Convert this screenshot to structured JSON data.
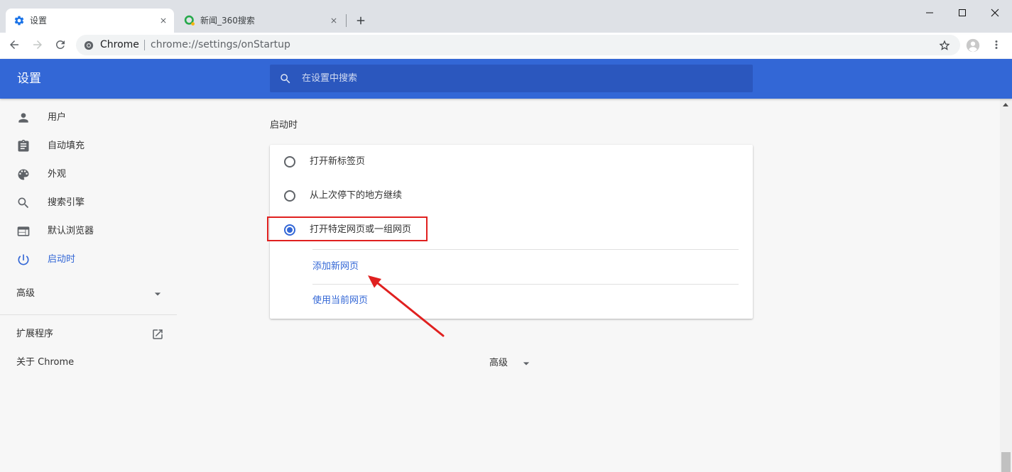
{
  "tabs": [
    {
      "title": "设置",
      "icon": "settings-gear-icon",
      "active": true
    },
    {
      "title": "新闻_360搜索",
      "icon": "360-search-icon",
      "active": false
    }
  ],
  "window_controls": [
    "minimize-icon",
    "maximize-icon",
    "close-icon"
  ],
  "toolbar": {
    "site_chip": "Chrome",
    "url": "chrome://settings/onStartup",
    "icons": [
      "back-arrow-icon",
      "forward-arrow-icon",
      "reload-icon",
      "bookmark-star-icon",
      "profile-avatar-icon",
      "more-menu-icon"
    ]
  },
  "header": {
    "title": "设置",
    "search_placeholder": "在设置中搜索"
  },
  "sidebar": {
    "items": [
      {
        "label": "用户",
        "icon": "person-icon",
        "active": false
      },
      {
        "label": "自动填充",
        "icon": "clipboard-icon",
        "active": false
      },
      {
        "label": "外观",
        "icon": "palette-icon",
        "active": false
      },
      {
        "label": "搜索引擎",
        "icon": "search-icon",
        "active": false
      },
      {
        "label": "默认浏览器",
        "icon": "browser-window-icon",
        "active": false
      },
      {
        "label": "启动时",
        "icon": "power-icon",
        "active": true
      }
    ],
    "advanced": "高级",
    "extensions": "扩展程序",
    "about": "关于 Chrome"
  },
  "startup": {
    "heading": "启动时",
    "options": [
      {
        "label": "打开新标签页",
        "checked": false
      },
      {
        "label": "从上次停下的地方继续",
        "checked": false
      },
      {
        "label": "打开特定网页或一组网页",
        "checked": true
      }
    ],
    "add_page": "添加新网页",
    "use_current": "使用当前网页"
  },
  "advanced_toggle": "高级",
  "colors": {
    "accent": "#3367d6",
    "header_bg": "#3367d6",
    "search_bg": "#2b57be",
    "annotation": "#e0201f",
    "tabstrip_bg": "#dee1e6"
  }
}
